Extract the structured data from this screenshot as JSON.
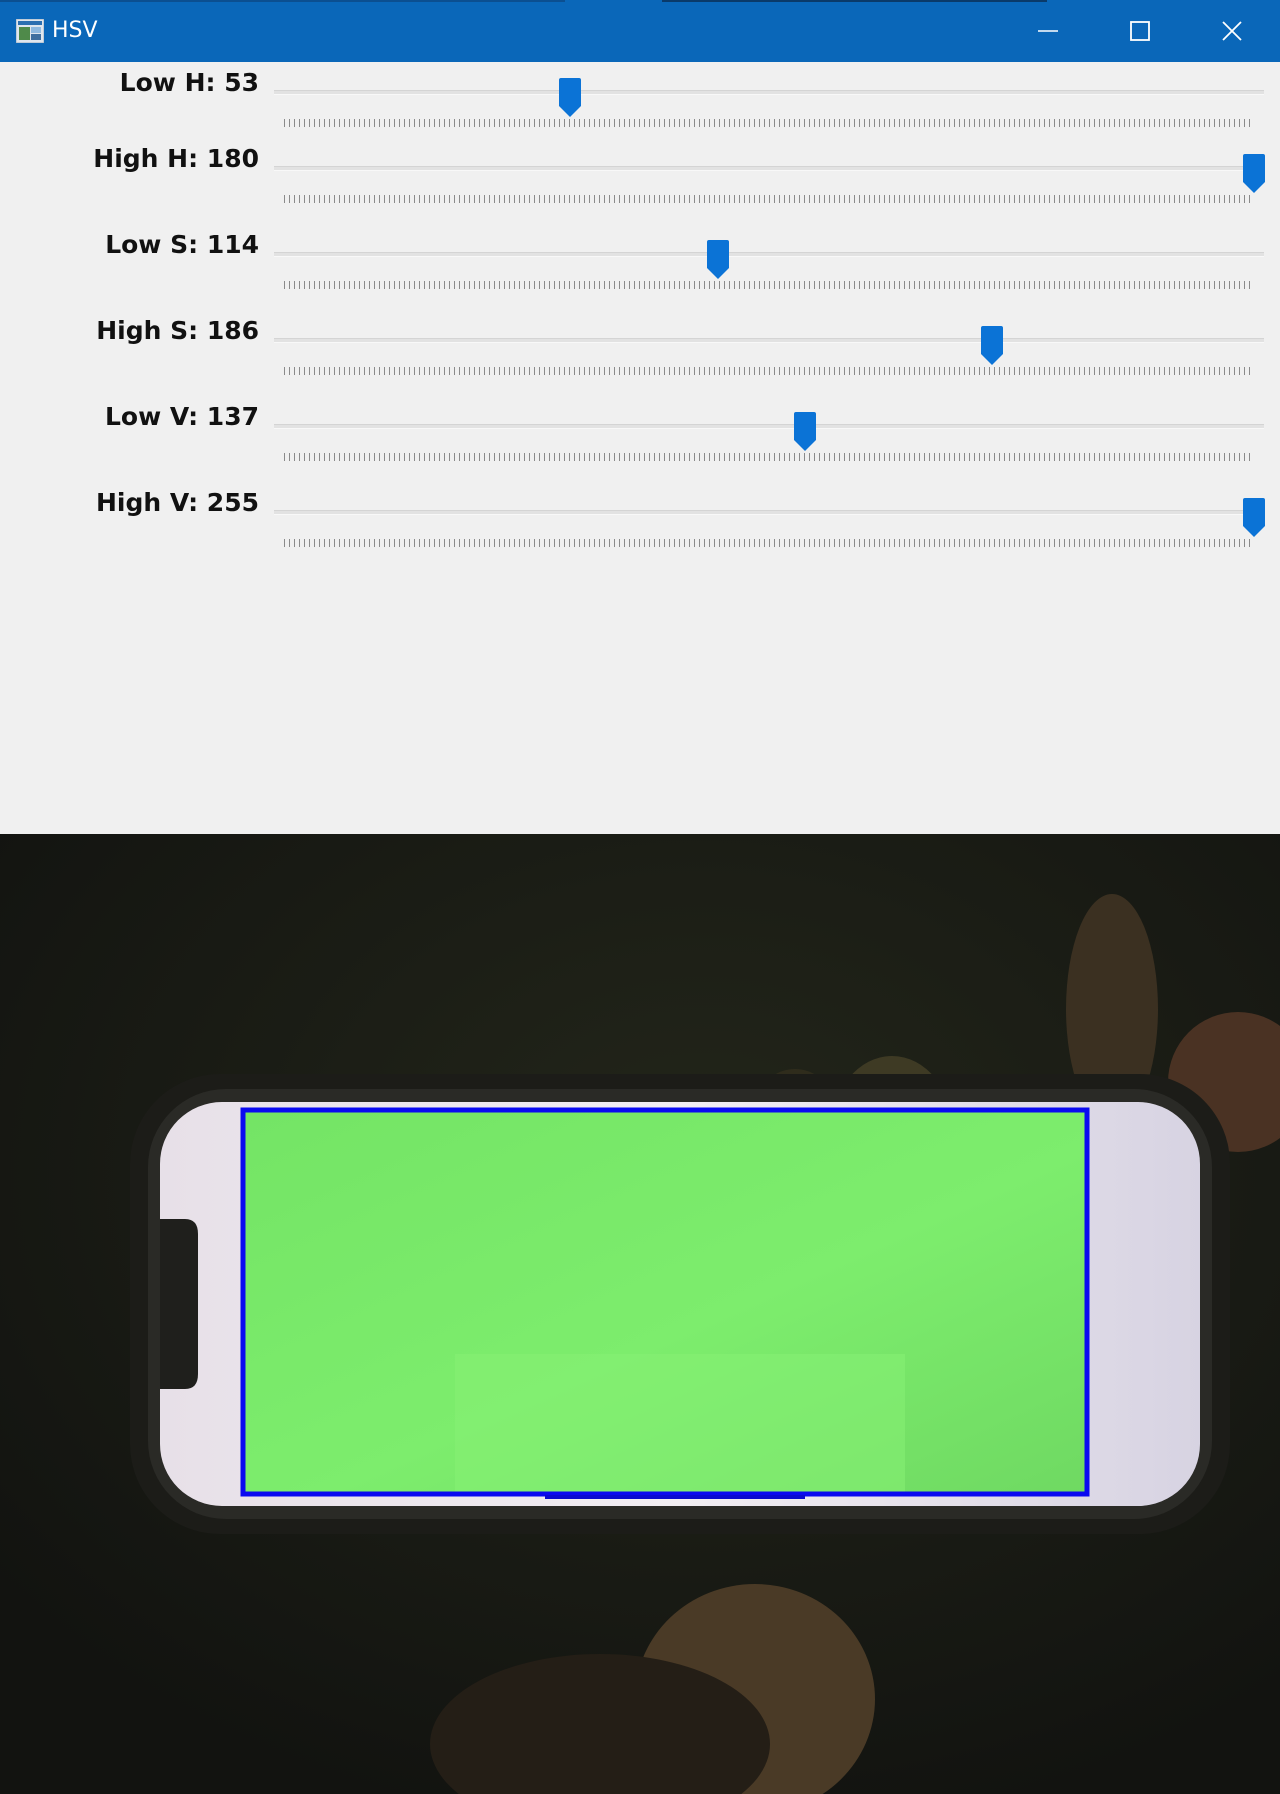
{
  "window": {
    "title": "HSV",
    "app_icon": "opencv-window-icon",
    "buttons": [
      {
        "name": "minimize-button",
        "icon": "minimize-icon"
      },
      {
        "name": "maximize-button",
        "icon": "maximize-icon"
      },
      {
        "name": "close-button",
        "icon": "close-icon"
      }
    ]
  },
  "colors": {
    "title_bar": "#0a67b9",
    "thumb": "#0b73d6",
    "panel_bg": "#f0f0f0",
    "detection_box": "#0a0af0",
    "screen_green": "#79e768"
  },
  "trackbars": [
    {
      "label": "Low H: 53",
      "value": 53,
      "max": 180
    },
    {
      "label": "High H: 180",
      "value": 180,
      "max": 180
    },
    {
      "label": "Low S: 114",
      "value": 114,
      "max": 255
    },
    {
      "label": "High S: 186",
      "value": 186,
      "max": 255
    },
    {
      "label": "Low V: 137",
      "value": 137,
      "max": 255
    },
    {
      "label": "High V: 255",
      "value": 255,
      "max": 255
    }
  ],
  "video": {
    "description_icon": "camera-frame",
    "detection_box_present": true
  }
}
